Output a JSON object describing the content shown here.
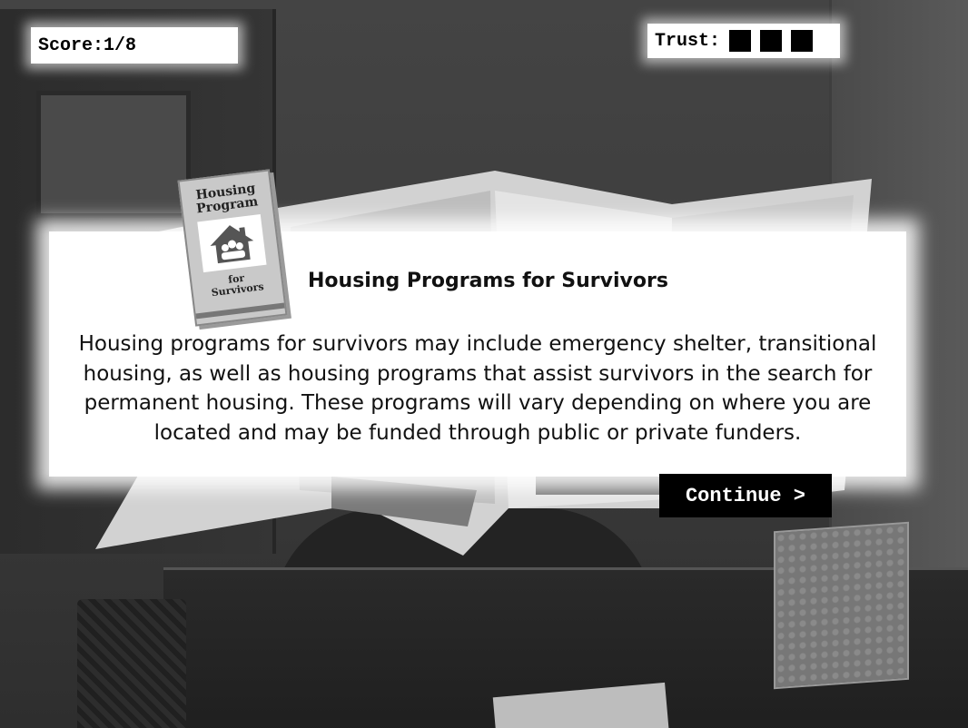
{
  "hud": {
    "score_label": "Score:1/8",
    "trust_label": "Trust:",
    "trust_level": 3
  },
  "dialog": {
    "title": "Housing Programs for Survivors",
    "body": "Housing programs for survivors may include emergency shelter, transitional housing, as well as housing programs that assist survivors in the search for permanent housing. These programs will vary depending on where you are located and may be funded through public or private funders."
  },
  "brochure": {
    "title_line1": "Housing",
    "title_line2": "Program",
    "sub_line1": "for",
    "sub_line2": "Survivors",
    "icon": "house-family-icon"
  },
  "actions": {
    "continue_label": "Continue >"
  },
  "colors": {
    "panel": "#ffffff",
    "button": "#000000",
    "text": "#111111"
  }
}
